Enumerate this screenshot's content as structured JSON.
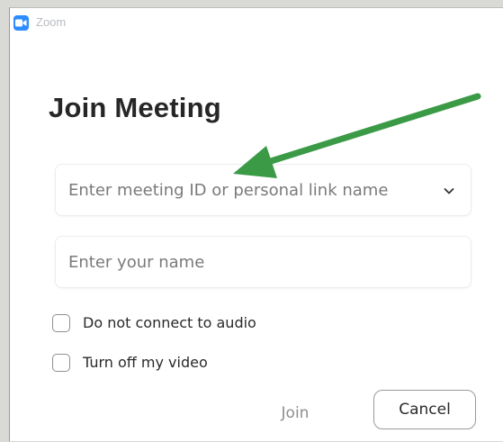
{
  "window": {
    "app_title": "Zoom",
    "app_icon": "zoom-camera-icon"
  },
  "main": {
    "heading": "Join Meeting",
    "meeting_field": {
      "placeholder": "Enter meeting ID or personal link name",
      "value": "",
      "dropdown_icon": "chevron-down-icon"
    },
    "name_field": {
      "placeholder": "Enter your name",
      "value": ""
    },
    "options": [
      {
        "label": "Do not connect to audio",
        "checked": false
      },
      {
        "label": "Turn off my video",
        "checked": false
      }
    ],
    "buttons": {
      "join_label": "Join",
      "cancel_label": "Cancel"
    }
  },
  "annotation": {
    "type": "arrow",
    "color": "#3a9a46",
    "points_to": "meeting-id-input"
  },
  "colors": {
    "zoom_blue": "#2d8cff",
    "disabled_text": "#8e8e8e"
  }
}
